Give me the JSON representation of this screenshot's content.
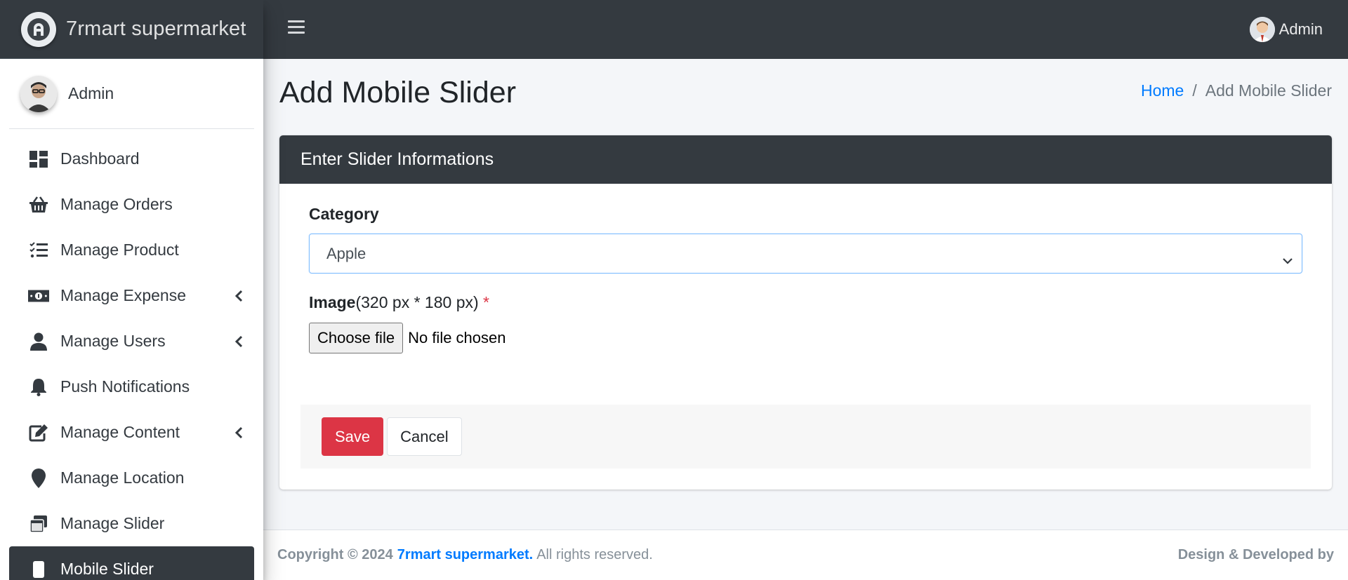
{
  "brand": {
    "name": "7rmart supermarket"
  },
  "sidebar": {
    "user_name": "Admin",
    "items": [
      {
        "label": "Dashboard",
        "icon": "dashboard-icon",
        "has_caret": false
      },
      {
        "label": "Manage Orders",
        "icon": "basket-icon",
        "has_caret": false
      },
      {
        "label": "Manage Product",
        "icon": "tasks-list-icon",
        "has_caret": false
      },
      {
        "label": "Manage Expense",
        "icon": "money-bill-icon",
        "has_caret": true
      },
      {
        "label": "Manage Users",
        "icon": "user-icon",
        "has_caret": true
      },
      {
        "label": "Push Notifications",
        "icon": "bell-icon",
        "has_caret": false
      },
      {
        "label": "Manage Content",
        "icon": "edit-icon",
        "has_caret": true
      },
      {
        "label": "Manage Location",
        "icon": "map-marker-icon",
        "has_caret": false
      },
      {
        "label": "Manage Slider",
        "icon": "window-restore-icon",
        "has_caret": false
      },
      {
        "label": "Mobile Slider",
        "icon": "mobile-icon",
        "has_caret": false,
        "active": true
      }
    ]
  },
  "topbar": {
    "user_name": "Admin"
  },
  "page": {
    "title": "Add Mobile Slider",
    "breadcrumb": {
      "home": "Home",
      "separator": "/",
      "current": "Add Mobile Slider"
    }
  },
  "form": {
    "header": "Enter Slider Informations",
    "category_label": "Category",
    "category_value": "Apple",
    "image_label": "Image",
    "image_hint": "(320 px * 180 px)",
    "required_mark": "*",
    "file_button": "Choose file",
    "file_status": "No file chosen",
    "save_label": "Save",
    "cancel_label": "Cancel"
  },
  "footer": {
    "copyright": "Copyright © 2024",
    "brand_link": "7rmart supermarket.",
    "rights": "All rights reserved.",
    "credit": "Design & Developed by"
  },
  "colors": {
    "dark": "#343a40",
    "primary": "#007bff",
    "danger": "#dc3545",
    "background": "#f4f6f9"
  }
}
